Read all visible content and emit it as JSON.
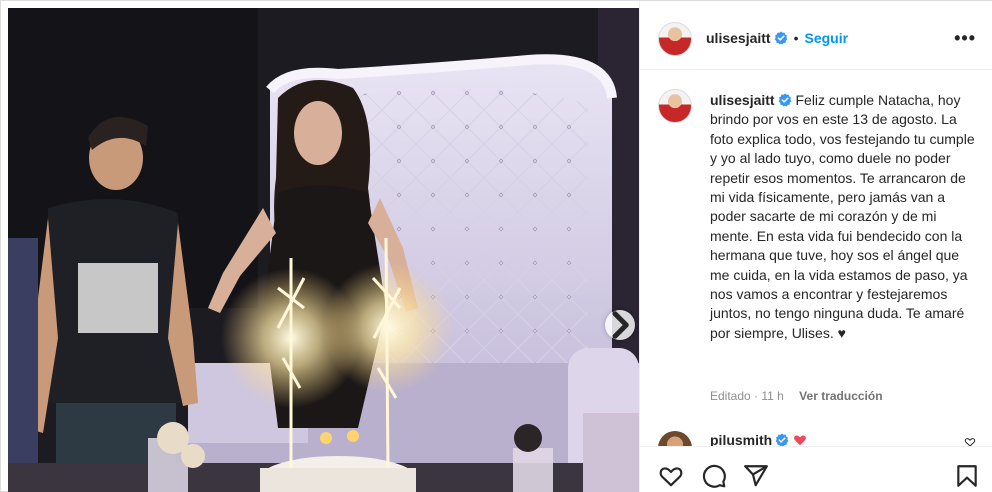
{
  "post": {
    "author": "ulisesjaitt",
    "follow_label": "Seguir",
    "dot": "•",
    "more_label": "•••",
    "caption_text": "Feliz cumple Natacha, hoy brindo por vos en este 13 de agosto. La foto explica todo, vos festejando tu cumple y yo al lado tuyo, como duele no poder repetir esos momentos. Te arrancaron de mi vida físicamente, pero jamás van a poder sacarte de mi corazón y de mi mente. En esta vida fui bendecido con la hermana que tuve, hoy sos el ángel que me cuida, en la vida estamos de paso, ya nos vamos a encontrar y festejaremos juntos, no tengo ninguna duda. Te amaré por siempre, Ulises. ♥",
    "edited_label": "Editado · 11 h",
    "translate_label": "Ver traducción"
  },
  "comment": {
    "username": "pilusmith"
  },
  "colors": {
    "accent": "#0095f6",
    "verified": "#3897f0",
    "heart": "#ed4956"
  },
  "icons": {
    "next": "chevron-right-icon",
    "like": "heart-icon",
    "comment": "comment-icon",
    "share": "paper-plane-icon",
    "save": "bookmark-icon"
  }
}
